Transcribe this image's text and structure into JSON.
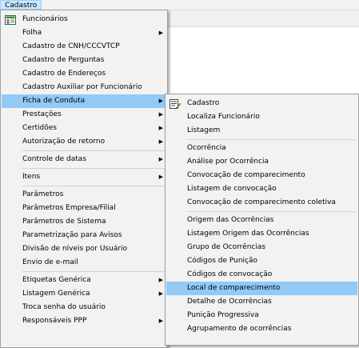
{
  "menubar": {
    "cadastro": "Cadastro"
  },
  "main_menu": {
    "funcionarios": "Funcionários",
    "folha": "Folha",
    "cnh": "Cadastro de CNH/CCCVTCP",
    "perguntas": "Cadastro de Perguntas",
    "enderecos": "Cadastro de Endereços",
    "auxiliar": "Cadastro Auxiliar por Funcionário",
    "ficha_conduta": "Ficha de Conduta",
    "prestacoes": "Prestações",
    "certidoes": "Certidões",
    "autorizacao": "Autorização de retorno",
    "controle_datas": "Controle de datas",
    "itens": "Itens",
    "parametros": "Parâmetros",
    "parametros_empresa": "Parâmetros Empresa/Filial",
    "parametros_sistema": "Parâmetros de Sistema",
    "parametrizacao_avisos": "Parametrização para Avisos",
    "divisao_niveis": "Divisão de níveis por Usuário",
    "envio_email": "Envio de e-mail",
    "etiquetas": "Etiquetas Genérica",
    "listagem_generica": "Listagem Genérica",
    "troca_senha": "Troca senha do usuário",
    "responsaveis_ppp": "Responsáveis PPP"
  },
  "sub_menu": {
    "cadastro": "Cadastro",
    "localiza": "Localiza Funcionário",
    "listagem": "Listagem",
    "ocorrencia": "Ocorrência",
    "analise": "Análise por Ocorrência",
    "convocacao_comparecimento": "Convocação de comparecimento",
    "listagem_convocacao": "Listagem de convocação",
    "convocacao_coletiva": "Convocação de comparecimento coletiva",
    "origem": "Origem das Ocorrências",
    "listagem_origem": "Listagem Origem das Ocorrências",
    "grupo": "Grupo de Ocorrências",
    "codigos_punicao": "Códigos de Punição",
    "codigos_convocacao": "Códigos de convocação",
    "local_comparecimento": "Local de comparecimento",
    "detalhe": "Detalhe de Ocorrências",
    "punicao_progressiva": "Punição Progressiva",
    "agrupamento": "Agrupamento de ocorrências"
  },
  "colors": {
    "highlight": "#91c9f7",
    "menu_bg": "#f2f2f2"
  },
  "icons": {
    "funcionarios": "people-grid-icon",
    "cadastro": "form-edit-icon",
    "submenu": "triangle-right-icon"
  }
}
